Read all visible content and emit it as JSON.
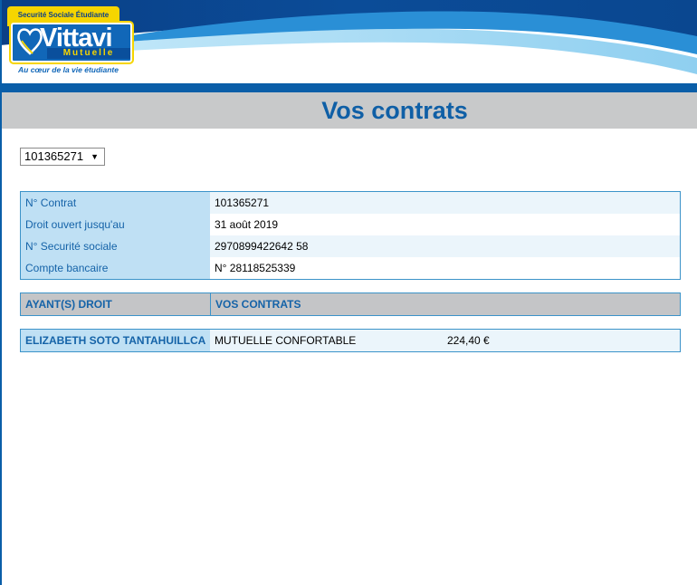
{
  "header": {
    "logo": {
      "top_tag": "Securité Sociale Étudiante",
      "brand": "Vittavi",
      "sub": "Mutuelle",
      "tagline": "Au cœur de la vie étudiante"
    }
  },
  "page": {
    "title": "Vos contrats"
  },
  "contract_selector": {
    "value": "101365271"
  },
  "contract_details": {
    "rows": [
      {
        "label": "N° Contrat",
        "value": "101365271"
      },
      {
        "label": "Droit ouvert jusqu'au",
        "value": "31 août 2019"
      },
      {
        "label": "N° Securité sociale",
        "value": "2970899422642 58"
      },
      {
        "label": "Compte bancaire",
        "value": "N° 28118525339"
      }
    ]
  },
  "beneficiaries": {
    "headers": {
      "ayants_droit": "AYANT(S) DROIT",
      "contrats": "VOS CONTRATS"
    },
    "rows": [
      {
        "name": "ELIZABETH SOTO TANTAHUILLCA",
        "contract": "MUTUELLE CONFORTABLE",
        "amount": "224,40 €"
      }
    ]
  },
  "colors": {
    "brand_blue": "#0a5ea8",
    "title_blue": "#0f5fa6",
    "logo_yellow": "#f6d500"
  }
}
